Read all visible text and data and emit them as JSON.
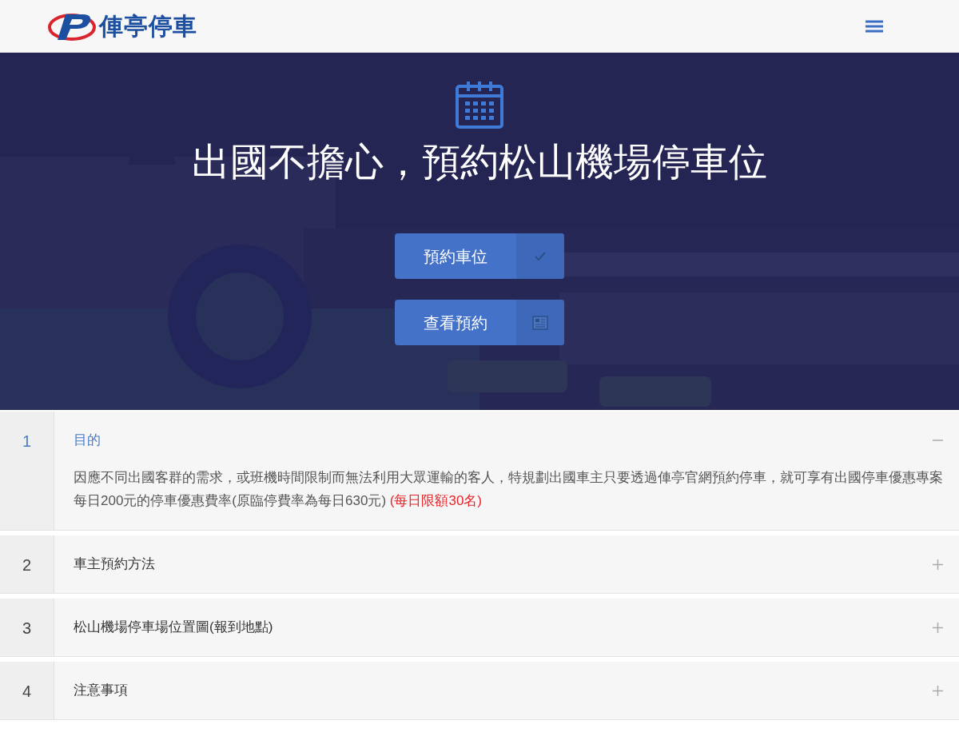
{
  "header": {
    "logo_text": "俥亭停車"
  },
  "hero": {
    "title": "出國不擔心，預約松山機場停車位",
    "buttons": [
      {
        "label": "預約車位",
        "kind": "check"
      },
      {
        "label": "查看預約",
        "kind": "document"
      }
    ]
  },
  "sections": [
    {
      "number": "1",
      "title": "目的",
      "expanded": true,
      "body": "因應不同出國客群的需求，或班機時間限制而無法利用大眾運輸的客人，特規劃出國車主只要透過俥亭官網預約停車，就可享有出國停車優惠專案每日200元的停車優惠費率(原臨停費率為每日630元)",
      "note": "(每日限額30名)"
    },
    {
      "number": "2",
      "title": "車主預約方法",
      "expanded": false
    },
    {
      "number": "3",
      "title": "松山機場停車場位置圖(報到地點)",
      "expanded": false
    },
    {
      "number": "4",
      "title": "注意事項",
      "expanded": false
    }
  ]
}
